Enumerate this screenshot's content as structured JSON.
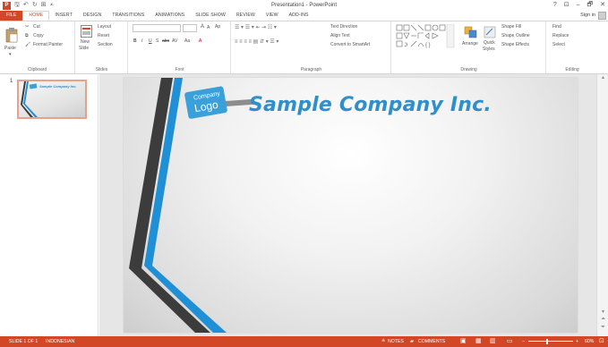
{
  "window": {
    "title": "Presentation1 - PowerPoint",
    "help": "?",
    "minimize": "–",
    "restore": "🗗",
    "close": "✕",
    "ribbon_display": "⊡"
  },
  "quick_access": {
    "save": "🖫",
    "undo": "↶",
    "redo": "↻",
    "present": "⊞",
    "customize": "⩡"
  },
  "tabs": [
    "FILE",
    "HOME",
    "INSERT",
    "DESIGN",
    "TRANSITIONS",
    "ANIMATIONS",
    "SLIDE SHOW",
    "REVIEW",
    "VIEW",
    "ADD-INS"
  ],
  "signin": "Sign in",
  "ribbon": {
    "clipboard": {
      "label": "Clipboard",
      "paste": "Paste",
      "cut": "Cut",
      "copy": "Copy",
      "format_painter": "Format Painter"
    },
    "slides": {
      "label": "Slides",
      "new_slide": "New",
      "new_slide2": "Slide",
      "layout": "Layout",
      "reset": "Reset",
      "section": "Section"
    },
    "font": {
      "label": "Font",
      "bold": "B",
      "italic": "I",
      "underline": "U",
      "strike": "S",
      "abc": "abc",
      "spacing": "AV",
      "case": "Aa",
      "color": "A",
      "grow": "A",
      "shrink": "A",
      "clear": "Ap"
    },
    "paragraph": {
      "label": "Paragraph",
      "text_direction": "Text Direction",
      "align_text": "Align Text",
      "smartart": "Convert to SmartArt"
    },
    "drawing": {
      "label": "Drawing",
      "arrange": "Arrange",
      "quick_styles": "Quick",
      "quick_styles2": "Styles",
      "shape_fill": "Shape Fill",
      "shape_outline": "Shape Outline",
      "shape_effects": "Shape Effects"
    },
    "editing": {
      "label": "Editing",
      "find": "Find",
      "replace": "Replace",
      "select": "Select"
    }
  },
  "thumbnail": {
    "number": "1",
    "title": "Sample Company Inc."
  },
  "slide": {
    "logo_line1": "Company",
    "logo_line2": "Logo",
    "title": "Sample Company Inc."
  },
  "statusbar": {
    "slide_info": "SLIDE 1 OF 1",
    "language": "INDONESIAN",
    "notes": "NOTES",
    "comments": "COMMENTS",
    "zoom_minus": "−",
    "zoom_plus": "+",
    "zoom": "60%"
  },
  "colors": {
    "accent": "#d24726",
    "slide_blue": "#2e8fcc",
    "stripe_dark": "#3c3c3c",
    "stripe_blue": "#1f8fd6"
  }
}
